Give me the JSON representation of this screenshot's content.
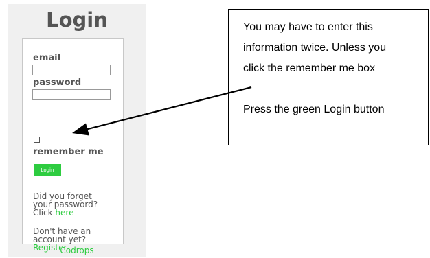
{
  "login": {
    "title": "Login",
    "email_label": "email",
    "password_label": "password",
    "remember_label": "remember me",
    "button_label": "Login",
    "forgot_line1": "Did you forget",
    "forgot_line2": "your password?",
    "forgot_click": "Click",
    "forgot_link": "here",
    "account_line1": "Don't have an",
    "account_line2": "account yet?",
    "register_link": "Register",
    "footer_link": "Codrops"
  },
  "annotation": {
    "line1": "You may have to enter this",
    "line2": "information twice. Unless you",
    "line3": "click the remember me box",
    "line4": "Press the green Login button"
  },
  "colors": {
    "accent_green": "#2ecc40",
    "panel_bg": "#f0f0f0",
    "text_grey": "#555555"
  }
}
